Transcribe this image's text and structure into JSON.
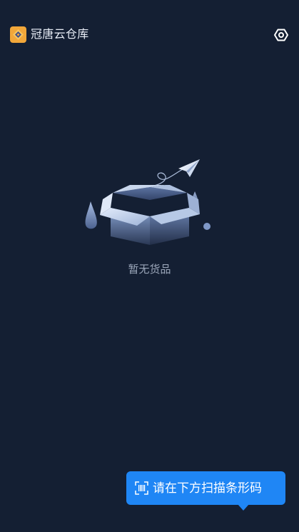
{
  "header": {
    "app_name": "冠唐云仓库",
    "logo_icon": "app-logo-icon",
    "settings_icon": "settings-icon"
  },
  "empty_state": {
    "icon": "empty-box-icon",
    "message": "暂无货品"
  },
  "scan_tip": {
    "icon": "barcode-scan-icon",
    "text": "请在下方扫描条形码"
  },
  "colors": {
    "background": "#141f33",
    "accent": "#1f86f5",
    "title_text": "#e9eef7",
    "muted_text": "#9aa5b8"
  }
}
